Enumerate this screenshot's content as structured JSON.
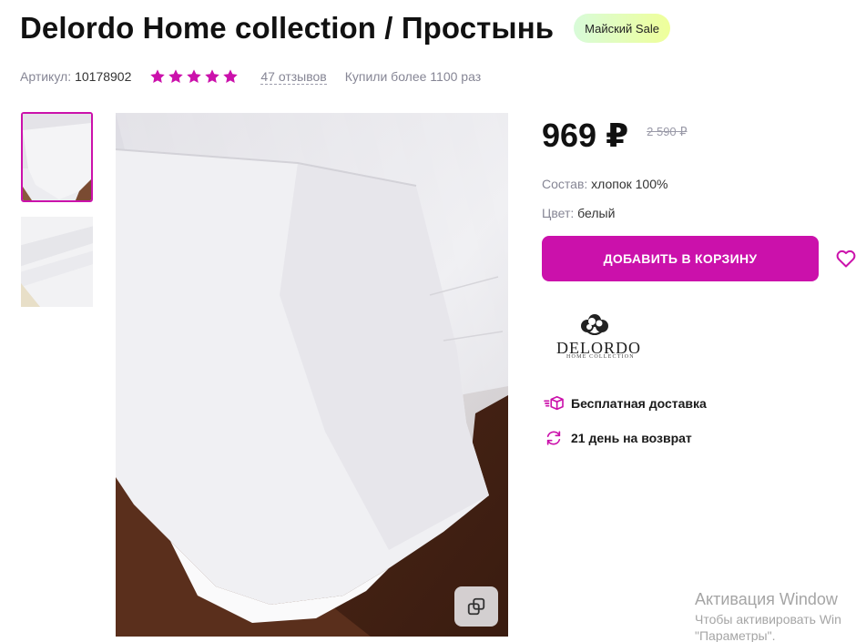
{
  "product": {
    "title": "Delordo Home collection / Простынь",
    "sale_badge": "Майский Sale",
    "sku_label": "Артикул:",
    "sku_value": "10178902",
    "rating_stars": 5,
    "reviews_text": "47 отзывов",
    "bought_text": "Купили более 1100 раз"
  },
  "gallery": {
    "thumbnails": [
      "thumbnail-1",
      "thumbnail-2"
    ],
    "active_thumbnail": 1
  },
  "price": {
    "current": "969 ₽",
    "old": "2 590 ₽"
  },
  "attributes": {
    "composition_label": "Состав:",
    "composition_value": "хлопок 100%",
    "color_label": "Цвет:",
    "color_value": "белый"
  },
  "actions": {
    "add_to_cart": "ДОБАВИТЬ В КОРЗИНУ"
  },
  "brand": {
    "name": "DELORDO",
    "subtitle": "HOME COLLECTION"
  },
  "features": [
    {
      "icon": "delivery-box-icon",
      "text": "Бесплатная доставка"
    },
    {
      "icon": "return-arrows-icon",
      "text": "21 день на возврат"
    }
  ],
  "watermark": {
    "line1": "Активация Window",
    "line2": "Чтобы активировать Win",
    "line3": "\"Параметры\"."
  },
  "colors": {
    "accent": "#cb11ab",
    "star": "#cb11ab",
    "badge_start": "#d8fbd9",
    "badge_end": "#efff9a",
    "muted_text": "#868695"
  }
}
